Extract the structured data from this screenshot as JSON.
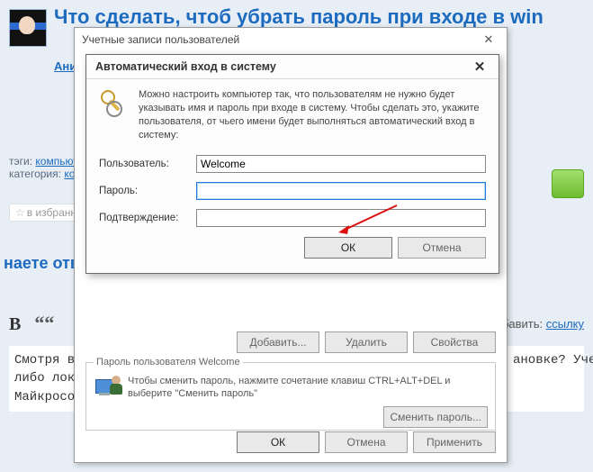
{
  "question": {
    "title": "Что сделать, чтоб убрать пароль при входе в win",
    "author": "Аникс [",
    "tags_label": "тэги:",
    "tag1": "компьютер",
    "category_label": "категория:",
    "category": "компь",
    "favorite_label": "в избранное",
    "answers_heading": "наете ответ",
    "add_label": "добавить:",
    "add_link": "ссылку",
    "answer_body": "Смотря в ка\nлибо локальн\nМайкрософт",
    "body_tail1": "ановке? Учетна",
    "body_tail2": ""
  },
  "parent_dialog": {
    "title": "Учетные записи пользователей",
    "btn_add": "Добавить...",
    "btn_del": "Удалить",
    "btn_props": "Свойства",
    "pwd_legend": "Пароль пользователя Welcome",
    "pwd_hint": "Чтобы сменить пароль, нажмите сочетание клавиш CTRL+ALT+DEL и выберите \"Сменить пароль\"",
    "pwd_btn": "Сменить пароль...",
    "ok": "ОК",
    "cancel": "Отмена",
    "apply": "Применить"
  },
  "child_dialog": {
    "title": "Автоматический вход в систему",
    "description": "Можно настроить компьютер так, что пользователям не нужно будет указывать имя и пароль при входе в систему. Чтобы сделать это, укажите пользователя, от чьего имени будет выполняться автоматический вход в систему:",
    "user_label": "Пользователь:",
    "user_value": "Welcome",
    "password_label": "Пароль:",
    "password_value": "",
    "confirm_label": "Подтверждение:",
    "confirm_value": "",
    "ok": "ОК",
    "cancel": "Отмена"
  }
}
